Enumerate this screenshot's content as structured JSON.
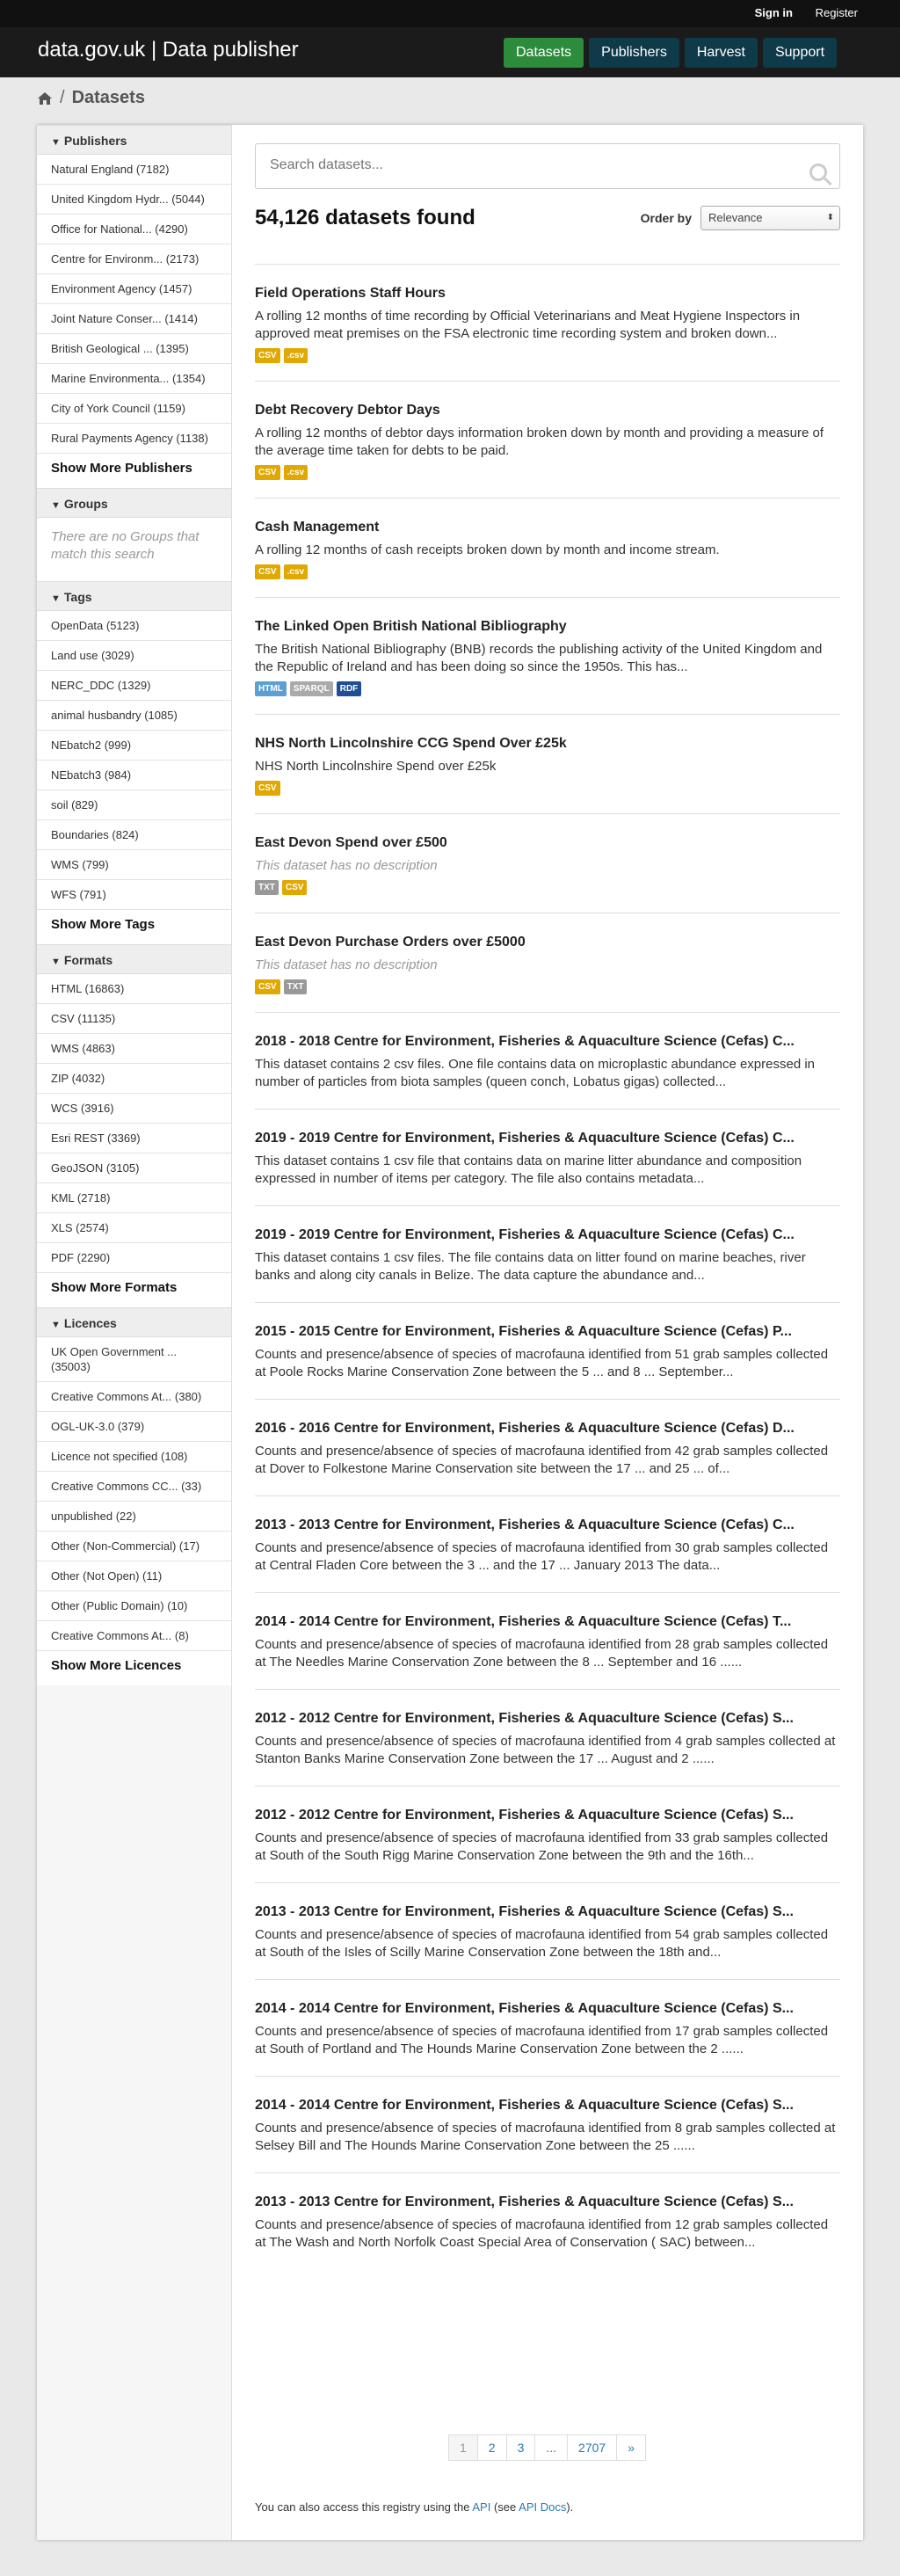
{
  "topbar": {
    "signin": "Sign in",
    "register": "Register"
  },
  "header": {
    "brand": "data.gov.uk | Data publisher",
    "nav": [
      "Datasets",
      "Publishers",
      "Harvest",
      "Support"
    ]
  },
  "breadcrumb": {
    "home_icon": "home-icon",
    "sep": "/",
    "current": "Datasets"
  },
  "facets": {
    "publishers": {
      "title": "Publishers",
      "items": [
        "Natural England (7182)",
        "United Kingdom Hydr... (5044)",
        "Office for National... (4290)",
        "Centre for Environm... (2173)",
        "Environment Agency (1457)",
        "Joint Nature Conser... (1414)",
        "British Geological ... (1395)",
        "Marine Environmenta... (1354)",
        "City of York Council (1159)",
        "Rural Payments Agency (1138)"
      ],
      "more": "Show More Publishers"
    },
    "groups": {
      "title": "Groups",
      "empty": "There are no Groups that match this search"
    },
    "tags": {
      "title": "Tags",
      "items": [
        "OpenData (5123)",
        "Land use (3029)",
        "NERC_DDC (1329)",
        "animal husbandry (1085)",
        "NEbatch2 (999)",
        "NEbatch3 (984)",
        "soil (829)",
        "Boundaries (824)",
        "WMS (799)",
        "WFS (791)"
      ],
      "more": "Show More Tags"
    },
    "formats": {
      "title": "Formats",
      "items": [
        "HTML (16863)",
        "CSV (11135)",
        "WMS (4863)",
        "ZIP (4032)",
        "WCS (3916)",
        "Esri REST (3369)",
        "GeoJSON (3105)",
        "KML (2718)",
        "XLS (2574)",
        "PDF (2290)"
      ],
      "more": "Show More Formats"
    },
    "licences": {
      "title": "Licences",
      "items": [
        "UK Open Government ... (35003)",
        "Creative Commons At... (380)",
        "OGL-UK-3.0 (379)",
        "Licence not specified (108)",
        "Creative Commons CC... (33)",
        "unpublished (22)",
        "Other (Non-Commercial) (17)",
        "Other (Not Open) (11)",
        "Other (Public Domain) (10)",
        "Creative Commons At... (8)"
      ],
      "more": "Show More Licences"
    }
  },
  "search": {
    "placeholder": "Search datasets..."
  },
  "results_count": "54,126 datasets found",
  "order": {
    "label": "Order by",
    "selected": "Relevance"
  },
  "colors": {
    "csv": "#e0a800",
    "html": "#5ba0d0",
    "sparql": "#aaaaaa",
    "rdf": "#1f4e96",
    "txt": "#999999"
  },
  "results": [
    {
      "title": "Field Operations Staff Hours",
      "desc": "A rolling 12 months of time recording by Official Veterinarians and Meat Hygiene Inspectors in approved meat premises on the FSA electronic time recording system and broken down...",
      "tags": [
        {
          "label": "CSV",
          "color": "#e0a800"
        },
        {
          "label": ".csv",
          "color": "#e0a800"
        }
      ]
    },
    {
      "title": "Debt Recovery Debtor Days",
      "desc": "A rolling 12 months of debtor days information broken down by month and providing a measure of the average time taken for debts to be paid.",
      "tags": [
        {
          "label": "CSV",
          "color": "#e0a800"
        },
        {
          "label": ".csv",
          "color": "#e0a800"
        }
      ]
    },
    {
      "title": "Cash Management",
      "desc": "A rolling 12 months of cash receipts broken down by month and income stream.",
      "tags": [
        {
          "label": "CSV",
          "color": "#e0a800"
        },
        {
          "label": ".csv",
          "color": "#e0a800"
        }
      ]
    },
    {
      "title": "The Linked Open British National Bibliography",
      "desc": "The British National Bibliography (BNB) records the publishing activity of the United Kingdom and the Republic of Ireland and has been doing so since the 1950s. This has...",
      "tags": [
        {
          "label": "HTML",
          "color": "#5ba0d0"
        },
        {
          "label": "SPARQL",
          "color": "#aaaaaa"
        },
        {
          "label": "RDF",
          "color": "#1f4e96"
        }
      ]
    },
    {
      "title": "NHS North Lincolnshire CCG Spend Over £25k",
      "desc": "NHS North Lincolnshire Spend over £25k",
      "tags": [
        {
          "label": "CSV",
          "color": "#e0a800"
        }
      ]
    },
    {
      "title": "East Devon Spend over £500",
      "desc": "This dataset has no description",
      "nodesc": true,
      "tags": [
        {
          "label": "TXT",
          "color": "#999999"
        },
        {
          "label": "CSV",
          "color": "#e0a800"
        }
      ]
    },
    {
      "title": "East Devon Purchase Orders over £5000",
      "desc": "This dataset has no description",
      "nodesc": true,
      "tags": [
        {
          "label": "CSV",
          "color": "#e0a800"
        },
        {
          "label": "TXT",
          "color": "#999999"
        }
      ]
    },
    {
      "title": "2018 - 2018 Centre for Environment, Fisheries & Aquaculture Science (Cefas) C...",
      "desc": "This dataset contains 2 csv files. One file contains data on microplastic abundance expressed in number of particles from biota samples (queen conch, Lobatus gigas) collected...",
      "tags": []
    },
    {
      "title": "2019 - 2019 Centre for Environment, Fisheries & Aquaculture Science (Cefas) C...",
      "desc": "This dataset contains 1 csv file that contains data on marine litter abundance and composition expressed in number of items per category. The file also contains metadata...",
      "tags": []
    },
    {
      "title": "2019 - 2019 Centre for Environment, Fisheries & Aquaculture Science (Cefas) C...",
      "desc": "This dataset contains 1 csv files. The file contains data on litter found on marine beaches, river banks and along city canals in Belize. The data capture the abundance and...",
      "tags": []
    },
    {
      "title": "2015 - 2015 Centre for Environment, Fisheries & Aquaculture Science (Cefas) P...",
      "desc": "Counts and presence/absence of species of macrofauna identified from 51 grab samples collected at Poole Rocks Marine Conservation Zone between the 5 ... and 8 ... September...",
      "tags": []
    },
    {
      "title": "2016 - 2016 Centre for Environment, Fisheries & Aquaculture Science (Cefas) D...",
      "desc": "Counts and presence/absence of species of macrofauna identified from 42 grab samples collected at Dover to Folkestone Marine Conservation site between the 17 ... and 25 ... of...",
      "tags": []
    },
    {
      "title": "2013 - 2013 Centre for Environment, Fisheries & Aquaculture Science (Cefas) C...",
      "desc": "Counts and presence/absence of species of macrofauna identified from 30 grab samples collected at Central Fladen Core between the 3 ... and the 17 ... January 2013 The data...",
      "tags": []
    },
    {
      "title": "2014 - 2014 Centre for Environment, Fisheries & Aquaculture Science (Cefas) T...",
      "desc": "Counts and presence/absence of species of macrofauna identified from 28 grab samples collected at The Needles Marine Conservation Zone between the 8 ... September and 16 ......",
      "tags": []
    },
    {
      "title": "2012 - 2012 Centre for Environment, Fisheries & Aquaculture Science (Cefas) S...",
      "desc": "Counts and presence/absence of species of macrofauna identified from 4 grab samples collected at Stanton Banks Marine Conservation Zone between the 17 ... August and 2 ......",
      "tags": []
    },
    {
      "title": "2012 - 2012 Centre for Environment, Fisheries & Aquaculture Science (Cefas) S...",
      "desc": "Counts and presence/absence of species of macrofauna identified from 33 grab samples collected at South of the South Rigg Marine Conservation Zone between the 9th and the 16th...",
      "tags": []
    },
    {
      "title": "2013 - 2013 Centre for Environment, Fisheries & Aquaculture Science (Cefas) S...",
      "desc": "Counts and presence/absence of species of macrofauna identified from 54 grab samples collected at South of the Isles of Scilly Marine Conservation Zone between the 18th and...",
      "tags": []
    },
    {
      "title": "2014 - 2014 Centre for Environment, Fisheries & Aquaculture Science (Cefas) S...",
      "desc": "Counts and presence/absence of species of macrofauna identified from 17 grab samples collected at South of Portland and The Hounds Marine Conservation Zone between the 2 ......",
      "tags": []
    },
    {
      "title": "2014 - 2014 Centre for Environment, Fisheries & Aquaculture Science (Cefas) S...",
      "desc": "Counts and presence/absence of species of macrofauna identified from 8 grab samples collected at Selsey Bill and The Hounds Marine Conservation Zone between the 25 ......",
      "tags": []
    },
    {
      "title": "2013 - 2013 Centre for Environment, Fisheries & Aquaculture Science (Cefas) S...",
      "desc": "Counts and presence/absence of species of macrofauna identified from 12 grab samples collected at The Wash and North Norfolk Coast Special Area of Conservation ( SAC) between...",
      "tags": []
    }
  ],
  "pagination": [
    "1",
    "2",
    "3",
    "...",
    "2707",
    "»"
  ],
  "footnote": {
    "pre": "You can also access this registry using the ",
    "api": "API",
    "mid": " (see ",
    "docs": "API Docs",
    "post": ")."
  }
}
